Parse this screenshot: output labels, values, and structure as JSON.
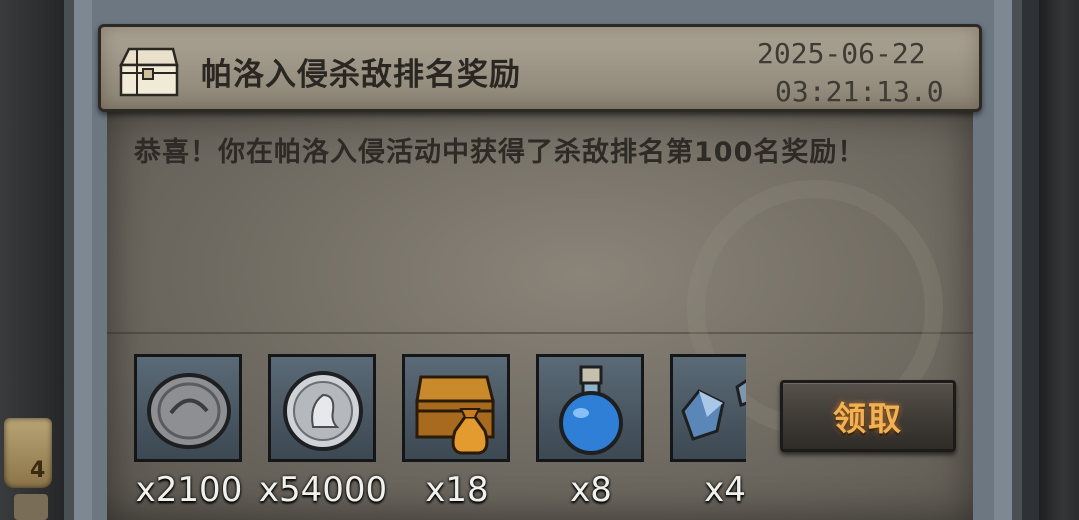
{
  "mail": {
    "title": "帕洛入侵杀敌排名奖励",
    "date": "2025-06-22",
    "time": "03:21:13.0",
    "message": "恭喜！你在帕洛入侵活动中获得了杀敌排名第100名奖励！",
    "icon": "treasure-chest-icon"
  },
  "rewards": [
    {
      "qty": "x2100",
      "icon": "dark-coin-icon"
    },
    {
      "qty": "x54000",
      "icon": "silver-coin-icon"
    },
    {
      "qty": "x18",
      "icon": "chest-and-bag-icon"
    },
    {
      "qty": "x8",
      "icon": "blue-potion-icon"
    },
    {
      "qty": "x4",
      "icon": "crystal-shard-icon"
    }
  ],
  "claim_label": "领取",
  "side": {
    "left_badge_text": "4"
  }
}
